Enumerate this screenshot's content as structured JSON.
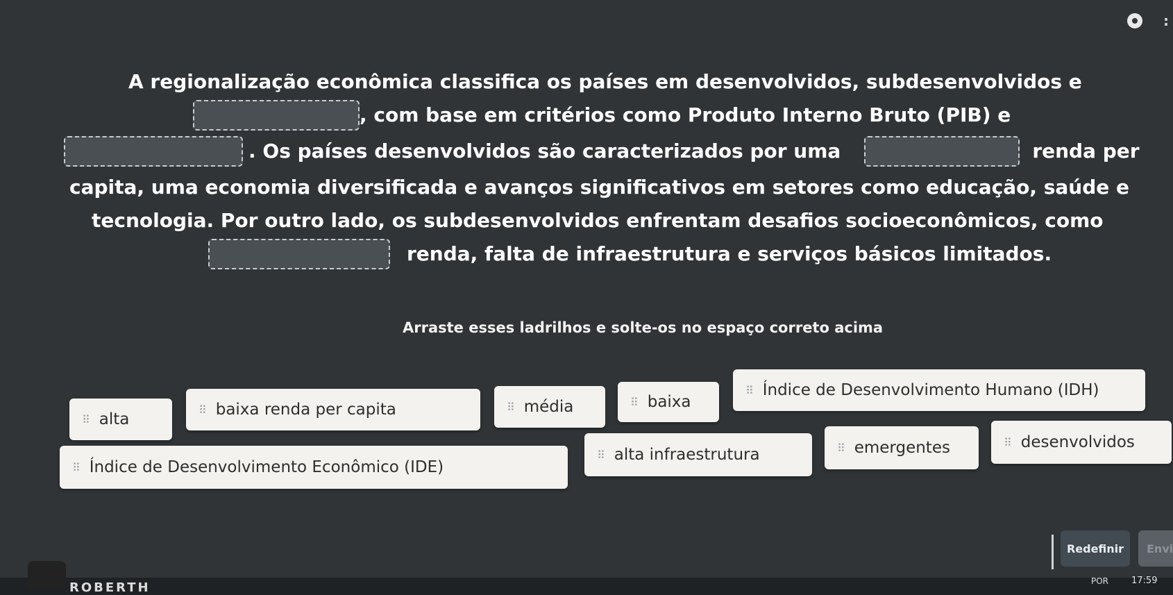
{
  "toolbar": {
    "settings_icon": "gear-icon",
    "more_icon": "more-icon",
    "more_glyph": ":"
  },
  "passage": {
    "line1": "A regionalização econômica classifica os países em desenvolvidos, subdesenvolvidos e",
    "line2_after_blank": ", com base em critérios como  Produto Interno Bruto (PIB) e",
    "line3_after_blank": ". Os países desenvolvidos são caracterizados por uma",
    "line3_end": "renda per",
    "line4": "capita, uma economia diversificada e avanços significativos em setores como educação, saúde e",
    "line5": "tecnologia. Por outro lado, os subdesenvolvidos enfrentam desafios socioeconômicos, como",
    "line6_after_blank": "renda, falta de infraestrutura e serviços básicos limitados."
  },
  "instruction": "Arraste esses ladrilhos e solte-os no espaço correto acima",
  "tiles": [
    {
      "label": "alta"
    },
    {
      "label": "baixa renda per capita"
    },
    {
      "label": "média"
    },
    {
      "label": "baixa"
    },
    {
      "label": "Índice de Desenvolvimento Humano (IDH)"
    },
    {
      "label": "Índice de Desenvolvimento Econômico (IDE)"
    },
    {
      "label": "alta infraestrutura"
    },
    {
      "label": "emergentes"
    },
    {
      "label": "desenvolvidos"
    }
  ],
  "grip_glyph": "⠿",
  "actions": {
    "reset_label": "Redefinir",
    "send_label": "Envi"
  },
  "footer": {
    "user_name": "ROBERTH",
    "language": "POR",
    "time": "17:59"
  }
}
